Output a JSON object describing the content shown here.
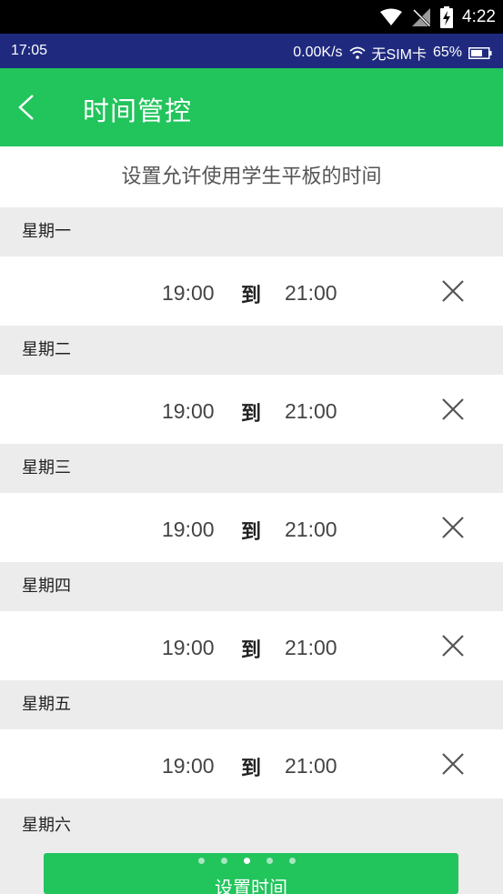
{
  "system_bar": {
    "clock": "4:22"
  },
  "status_bar": {
    "time": "17:05",
    "speed": "0.00K/s",
    "sim": "无SIM卡",
    "battery": "65%"
  },
  "app_bar": {
    "title": "时间管控"
  },
  "subtitle": "设置允许使用学生平板的时间",
  "separator": "到",
  "days": [
    {
      "name": "星期一",
      "start": "19:00",
      "end": "21:00"
    },
    {
      "name": "星期二",
      "start": "19:00",
      "end": "21:00"
    },
    {
      "name": "星期三",
      "start": "19:00",
      "end": "21:00"
    },
    {
      "name": "星期四",
      "start": "19:00",
      "end": "21:00"
    },
    {
      "name": "星期五",
      "start": "19:00",
      "end": "21:00"
    },
    {
      "name": "星期六"
    }
  ],
  "button": {
    "label": "设置时间"
  },
  "pager": {
    "count": 5,
    "active": 3
  },
  "colors": {
    "primary": "#22c45c",
    "status_bar": "#1f2a7e",
    "row_header": "#ececec"
  }
}
